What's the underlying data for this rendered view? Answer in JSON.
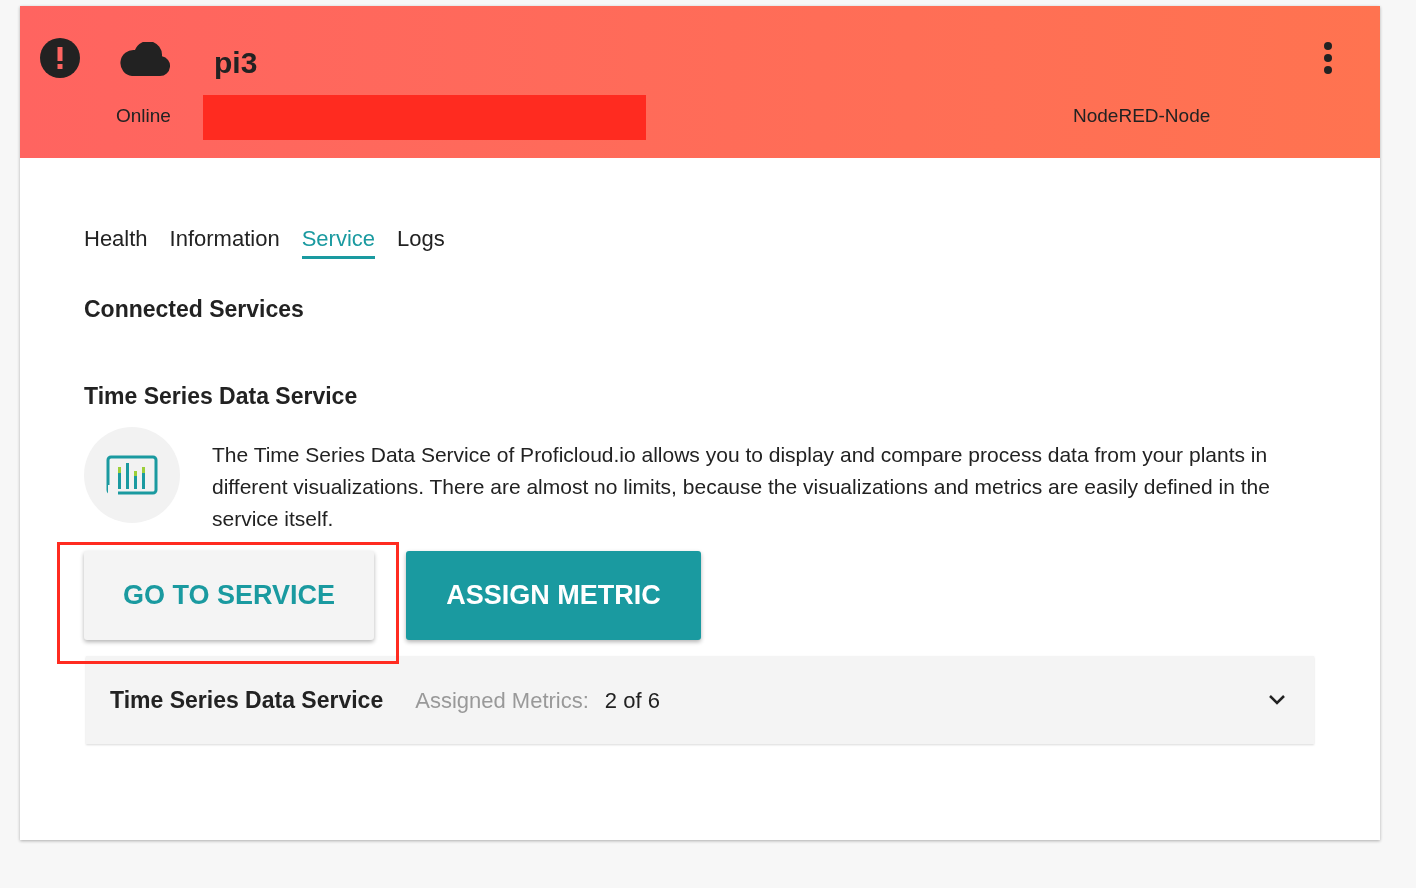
{
  "header": {
    "title": "pi3",
    "status": "Online",
    "device_type": "NodeRED-Node",
    "alert": true
  },
  "tabs": [
    {
      "label": "Health",
      "selected": false
    },
    {
      "label": "Information",
      "selected": false
    },
    {
      "label": "Service",
      "selected": true
    },
    {
      "label": "Logs",
      "selected": false
    }
  ],
  "section_title": "Connected Services",
  "service": {
    "title": "Time Series Data Service",
    "description": "The Time Series Data Service of Proficloud.io allows you to display and compare process data from your plants in different visualizations. There are almost no limits, because the visualizations and metrics are easily defined in the service itself.",
    "buttons": [
      {
        "label": "GO TO SERVICE",
        "kind": "secondary",
        "highlighted": true
      },
      {
        "label": "ASSIGN METRIC",
        "kind": "primary",
        "highlighted": false
      }
    ]
  },
  "panel": {
    "title": "Time Series Data Service",
    "metrics_label": "Assigned Metrics:",
    "metrics_value": "2 of 6",
    "expanded": false
  }
}
